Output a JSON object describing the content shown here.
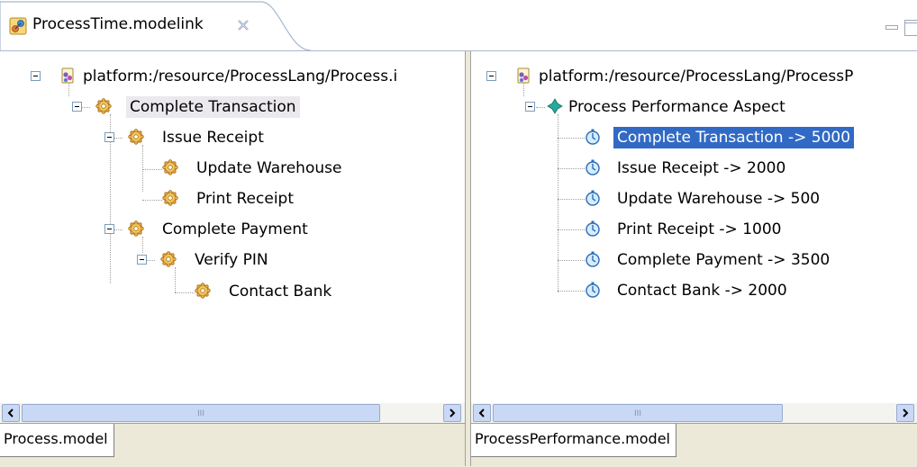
{
  "editor": {
    "tab_title": "ProcessTime.modelink",
    "tab_icon": "modelink-icon",
    "close_icon": "close-icon"
  },
  "left_pane": {
    "root": "platform:/resource/ProcessLang/Process.i",
    "items": [
      {
        "label": "Complete Transaction",
        "icon": "process-gear-icon"
      },
      {
        "label": "Issue Receipt",
        "icon": "process-gear-icon"
      },
      {
        "label": "Update Warehouse",
        "icon": "process-gear-icon"
      },
      {
        "label": "Print Receipt",
        "icon": "process-gear-icon"
      },
      {
        "label": "Complete Payment",
        "icon": "process-gear-icon"
      },
      {
        "label": "Verify PIN",
        "icon": "process-gear-icon"
      },
      {
        "label": "Contact Bank",
        "icon": "process-gear-icon"
      }
    ],
    "scroll_grip": "III",
    "bottom_tab": "Process.model"
  },
  "right_pane": {
    "root": "platform:/resource/ProcessLang/ProcessP",
    "aspect": "Process Performance Aspect",
    "items": [
      {
        "label": "Complete Transaction -> 5000",
        "icon": "stopwatch-icon",
        "selected": true
      },
      {
        "label": "Issue Receipt -> 2000",
        "icon": "stopwatch-icon"
      },
      {
        "label": "Update Warehouse -> 500",
        "icon": "stopwatch-icon"
      },
      {
        "label": "Print Receipt -> 1000",
        "icon": "stopwatch-icon"
      },
      {
        "label": "Complete Payment -> 3500",
        "icon": "stopwatch-icon"
      },
      {
        "label": "Contact Bank -> 2000",
        "icon": "stopwatch-icon"
      }
    ],
    "scroll_grip": "III",
    "bottom_tab": "ProcessPerformance.model"
  },
  "colors": {
    "selection": "#316ac5",
    "tab_border": "#a8b8cf",
    "scroll_button": "#c9d9f5"
  }
}
